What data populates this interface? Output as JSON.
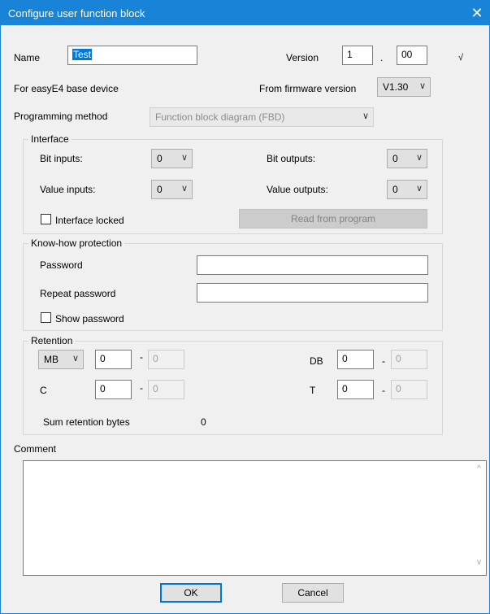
{
  "window": {
    "title": "Configure user function block",
    "close_glyph": "✕"
  },
  "name": {
    "label": "Name",
    "value": "Test"
  },
  "version": {
    "label": "Version",
    "major": "1",
    "separator": ".",
    "minor": "00",
    "check": "√"
  },
  "base_device": {
    "label": "For easyE4 base device"
  },
  "firmware": {
    "label": "From firmware version",
    "selected": "V1.30"
  },
  "programming": {
    "label": "Programming method",
    "selected": "Function block diagram (FBD)"
  },
  "interface": {
    "title": "Interface",
    "bit_inputs": {
      "label": "Bit inputs:",
      "selected": "0"
    },
    "bit_outputs": {
      "label": "Bit outputs:",
      "selected": "0"
    },
    "value_inputs": {
      "label": "Value inputs:",
      "selected": "0"
    },
    "value_outputs": {
      "label": "Value outputs:",
      "selected": "0"
    },
    "locked": {
      "label": "Interface locked",
      "checked": false
    },
    "read_button": "Read from program"
  },
  "knowhow": {
    "title": "Know-how protection",
    "password_label": "Password",
    "password_value": "",
    "repeat_label": "Repeat password",
    "repeat_value": "",
    "show_label": "Show password",
    "show_checked": false
  },
  "retention": {
    "title": "Retention",
    "mb": {
      "selected": "MB",
      "from": "0",
      "dash": "-",
      "to": "0"
    },
    "db": {
      "label": "DB",
      "from": "0",
      "dash": "-",
      "to": "0"
    },
    "c": {
      "label": "C",
      "from": "0",
      "dash": "-",
      "to": "0"
    },
    "t": {
      "label": "T",
      "from": "0",
      "dash": "-",
      "to": "0"
    },
    "sum_label": "Sum retention bytes",
    "sum_value": "0"
  },
  "comment": {
    "label": "Comment",
    "value": ""
  },
  "buttons": {
    "ok": "OK",
    "cancel": "Cancel"
  },
  "icons": {
    "chevron": "∨",
    "scroll_up": "^",
    "scroll_down": "v"
  },
  "colors": {
    "titlebar": "#1883d7",
    "selection": "#0078d7",
    "dialog_bg": "#f0f0f0"
  }
}
